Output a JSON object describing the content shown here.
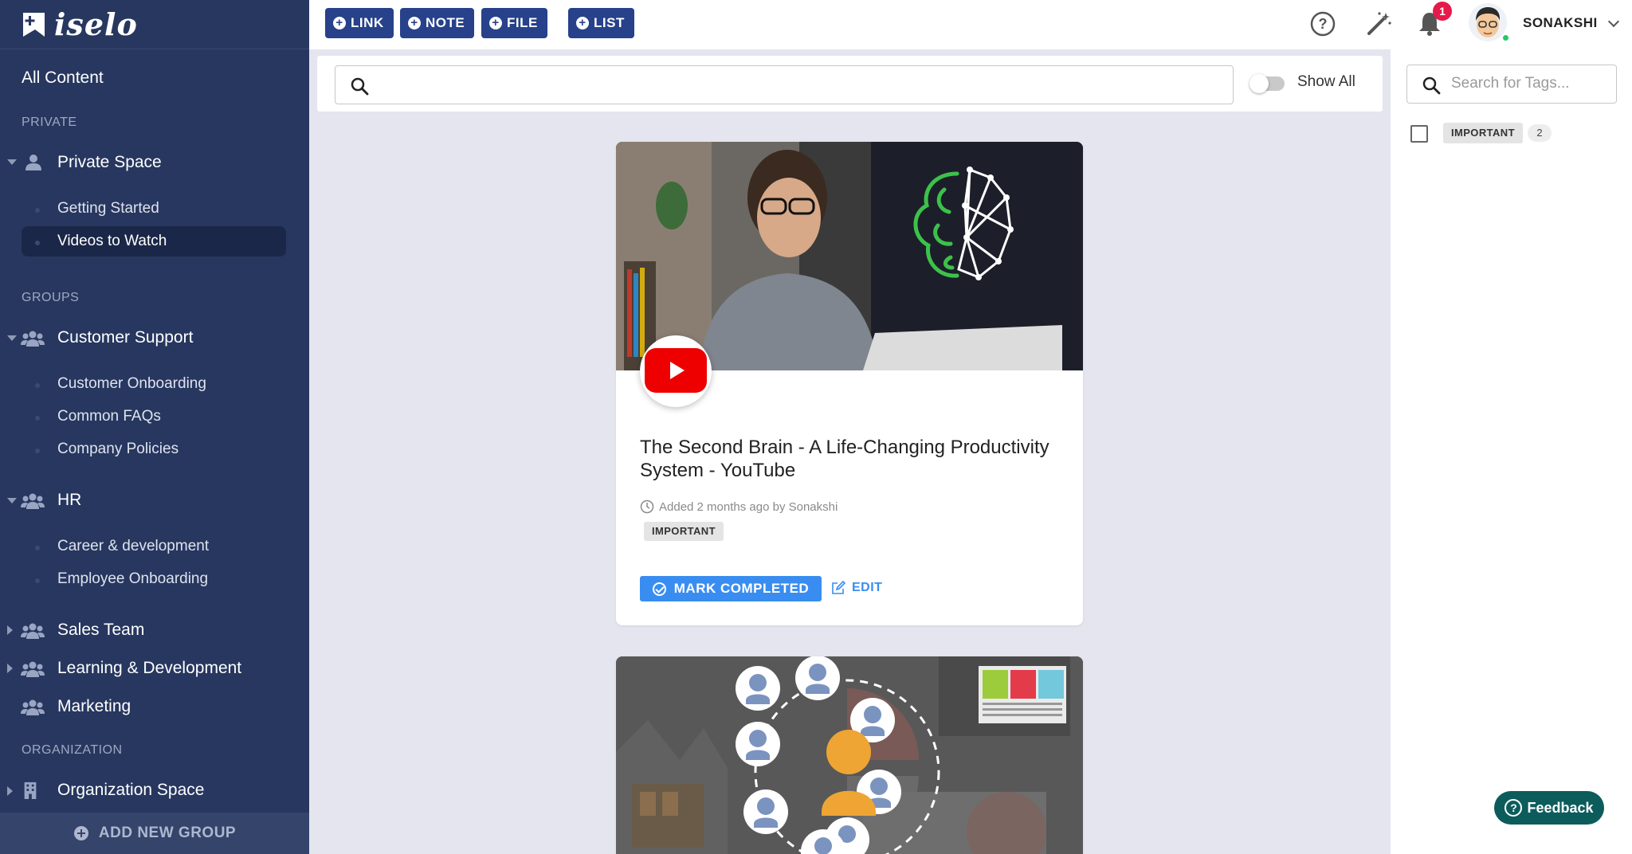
{
  "app": {
    "name": "iselo"
  },
  "sidebar": {
    "all_content": "All Content",
    "private_section": "PRIVATE",
    "private_space": "Private Space",
    "private_items": [
      "Getting Started",
      "Videos to Watch"
    ],
    "groups_section": "GROUPS",
    "groups": [
      {
        "label": "Customer Support",
        "items": [
          "Customer Onboarding",
          "Common FAQs",
          "Company Policies"
        ]
      },
      {
        "label": "HR",
        "items": [
          "Career & development",
          "Employee Onboarding"
        ]
      },
      {
        "label": "Sales Team"
      },
      {
        "label": "Learning & Development"
      },
      {
        "label": "Marketing"
      }
    ],
    "organization_section": "ORGANIZATION",
    "organization_space": "Organization Space",
    "add_group": "ADD NEW GROUP"
  },
  "topbar": {
    "buttons": [
      "LINK",
      "NOTE",
      "FILE",
      "LIST"
    ],
    "notification_count": "1",
    "username": "SONAKSHI"
  },
  "search": {
    "placeholder": "",
    "show_all_label": "Show All",
    "show_all_enabled": false
  },
  "tags_panel": {
    "placeholder": "Search for Tags...",
    "tags": [
      {
        "label": "IMPORTANT",
        "count": "2"
      }
    ]
  },
  "cards": [
    {
      "title": "The Second Brain - A Life-Changing Productivity System - YouTube",
      "meta": "Added 2 months ago by Sonakshi",
      "tag": "IMPORTANT",
      "primary_action": "MARK COMPLETED",
      "secondary_action": "EDIT"
    }
  ],
  "feedback": {
    "label": "Feedback"
  },
  "colors": {
    "sidebar_bg": "#27375f",
    "accent_blue": "#3a8df0",
    "button_navy": "#27418a",
    "badge_red": "#e6194b",
    "feedback_teal": "#0d5c5c"
  }
}
